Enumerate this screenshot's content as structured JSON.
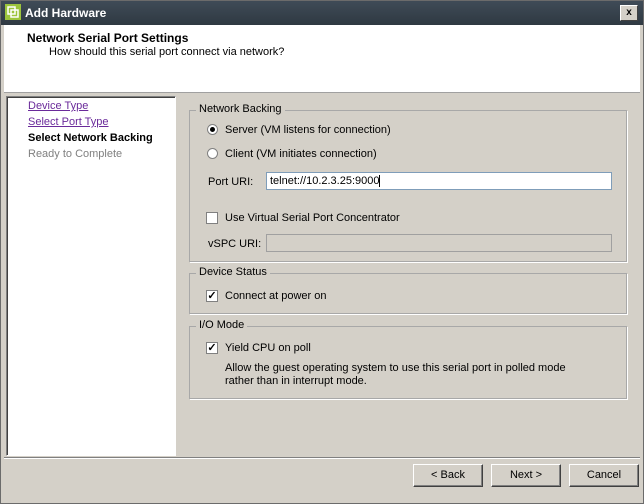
{
  "window": {
    "title": "Add Hardware",
    "close_label": "x"
  },
  "header": {
    "title": "Network Serial Port Settings",
    "subtitle": "How should this serial port connect via network?"
  },
  "nav": {
    "items": [
      {
        "label": "Device Type",
        "state": "link"
      },
      {
        "label": "Select Port Type",
        "state": "link"
      },
      {
        "label": "Select Network Backing",
        "state": "current"
      },
      {
        "label": "Ready to Complete",
        "state": "disabled"
      }
    ]
  },
  "network_backing": {
    "group_label": "Network Backing",
    "server_label": "Server (VM listens for connection)",
    "server_selected": true,
    "client_label": "Client  (VM initiates connection)",
    "client_selected": false,
    "port_uri_label": "Port URI:",
    "port_uri_value": "telnet://10.2.3.25:9000",
    "use_vspc_label": "Use Virtual Serial Port Concentrator",
    "use_vspc_checked": false,
    "vspc_uri_label": "vSPC URI:",
    "vspc_uri_value": ""
  },
  "device_status": {
    "group_label": "Device Status",
    "connect_label": "Connect at power on",
    "connect_checked": true
  },
  "io_mode": {
    "group_label": "I/O Mode",
    "yield_label": "Yield CPU on poll",
    "yield_checked": true,
    "description": "Allow the guest operating system to use this serial port in polled mode rather than in interrupt mode."
  },
  "buttons": {
    "back": "< Back",
    "next": "Next >",
    "cancel": "Cancel"
  },
  "colors": {
    "titlebar": "#38434d",
    "link": "#6a2a9a",
    "disabled": "#808080"
  }
}
